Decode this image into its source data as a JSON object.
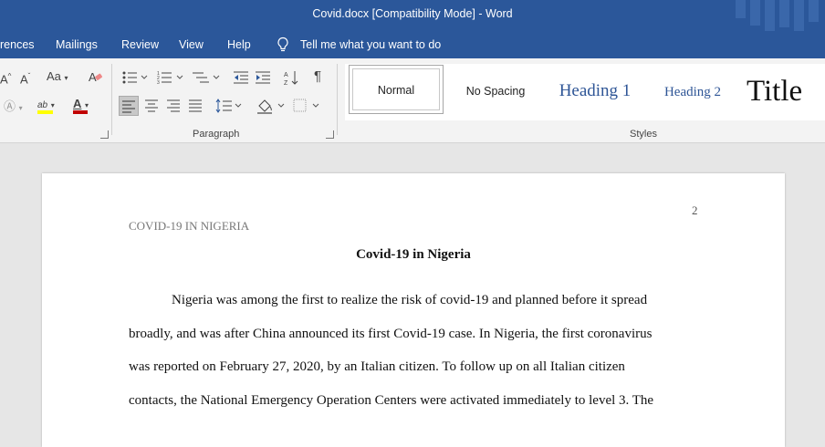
{
  "window": {
    "title": "Covid.docx [Compatibility Mode]  -  Word"
  },
  "menu": {
    "items": [
      "rences",
      "Mailings",
      "Review",
      "View",
      "Help"
    ],
    "tell_me": "Tell me what you want to do"
  },
  "ribbon": {
    "groups": {
      "paragraph": "Paragraph",
      "styles": "Styles"
    },
    "font": {
      "change_case": "Aa",
      "highlight_label": "ab",
      "font_color_label": "A"
    },
    "styles": [
      "Normal",
      "No Spacing",
      "Heading 1",
      "Heading 2",
      "Title"
    ]
  },
  "colors": {
    "accent": "#2b579a",
    "heading": "#2e5596",
    "highlight": "#ffff00",
    "font_color": "#c00000"
  },
  "document": {
    "page_number": "2",
    "running_head": "COVID-19 IN NIGERIA",
    "title": "Covid-19 in Nigeria",
    "lines": [
      "Nigeria was among the first to realize the risk of covid-19 and planned before it spread",
      "broadly, and was after China announced its first Covid-19 case. In Nigeria, the first coronavirus",
      "was reported on February 27, 2020, by an Italian citizen. To follow up on all Italian citizen",
      "contacts, the National Emergency Operation Centers were activated immediately to level 3. The"
    ]
  }
}
